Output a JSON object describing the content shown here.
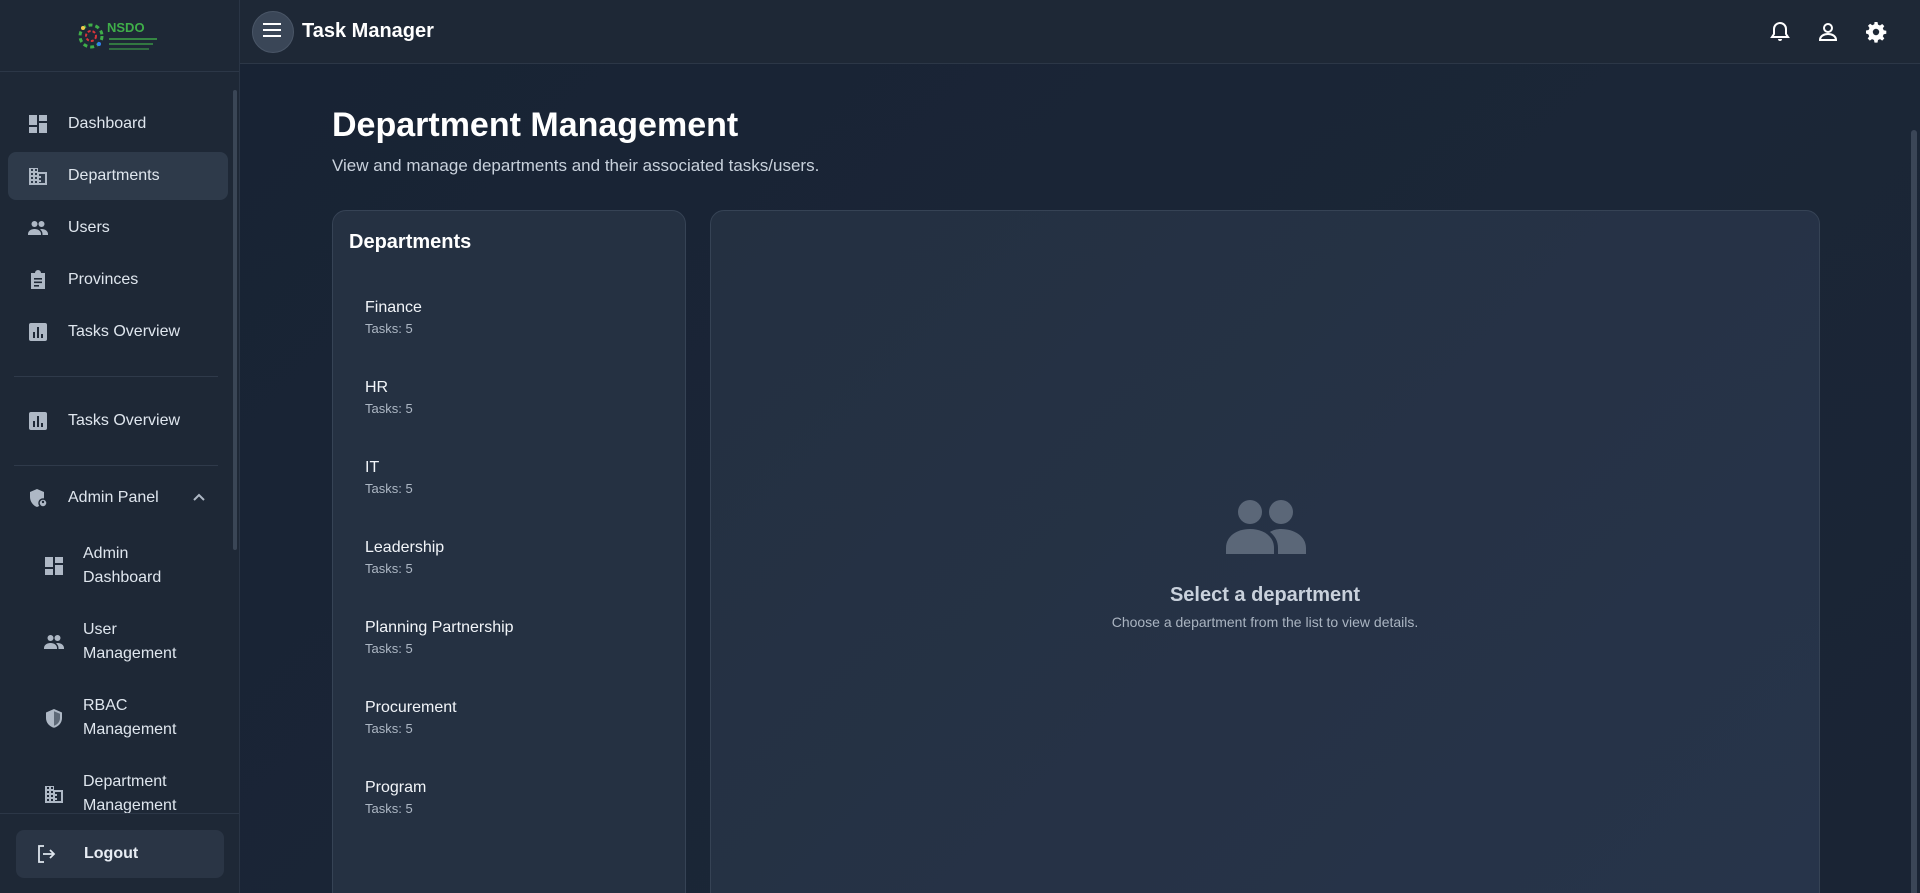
{
  "app": {
    "title": "Task Manager",
    "logo_text": "NSDO"
  },
  "sidebar": {
    "items": [
      {
        "label": "Dashboard",
        "icon": "dashboard-icon"
      },
      {
        "label": "Departments",
        "icon": "building-icon",
        "active": true
      },
      {
        "label": "Users",
        "icon": "people-icon"
      },
      {
        "label": "Provinces",
        "icon": "clipboard-icon"
      },
      {
        "label": "Tasks Overview",
        "icon": "bar-chart-icon"
      }
    ],
    "secondary_items": [
      {
        "label": "Tasks Overview",
        "icon": "bar-chart-icon"
      }
    ],
    "admin_panel": {
      "label": "Admin Panel",
      "icon": "admin-shield-icon",
      "expanded": true,
      "children": [
        {
          "label": "Admin Dashboard",
          "icon": "dashboard-icon"
        },
        {
          "label": "User Management",
          "icon": "people-icon"
        },
        {
          "label": "RBAC Management",
          "icon": "shield-icon"
        },
        {
          "label": "Department Management",
          "icon": "building-icon"
        }
      ]
    },
    "logout_label": "Logout"
  },
  "header": {
    "icons": [
      "bell-icon",
      "user-icon",
      "gear-icon"
    ]
  },
  "main": {
    "title": "Department Management",
    "subtitle": "View and manage departments and their associated tasks/users.",
    "departments_card": {
      "title": "Departments",
      "items": [
        {
          "name": "Finance",
          "tasks": "Tasks: 5"
        },
        {
          "name": "HR",
          "tasks": "Tasks: 5"
        },
        {
          "name": "IT",
          "tasks": "Tasks: 5"
        },
        {
          "name": "Leadership",
          "tasks": "Tasks: 5"
        },
        {
          "name": "Planning Partnership",
          "tasks": "Tasks: 5"
        },
        {
          "name": "Procurement",
          "tasks": "Tasks: 5"
        },
        {
          "name": "Program",
          "tasks": "Tasks: 5"
        }
      ]
    },
    "empty_state": {
      "title": "Select a department",
      "subtitle": "Choose a department from the list to view details."
    }
  },
  "colors": {
    "background": "#16202f",
    "sidebar": "#1e2836",
    "card": "#253142",
    "logo_green": "#3fae49",
    "logo_red": "#d9343a"
  }
}
